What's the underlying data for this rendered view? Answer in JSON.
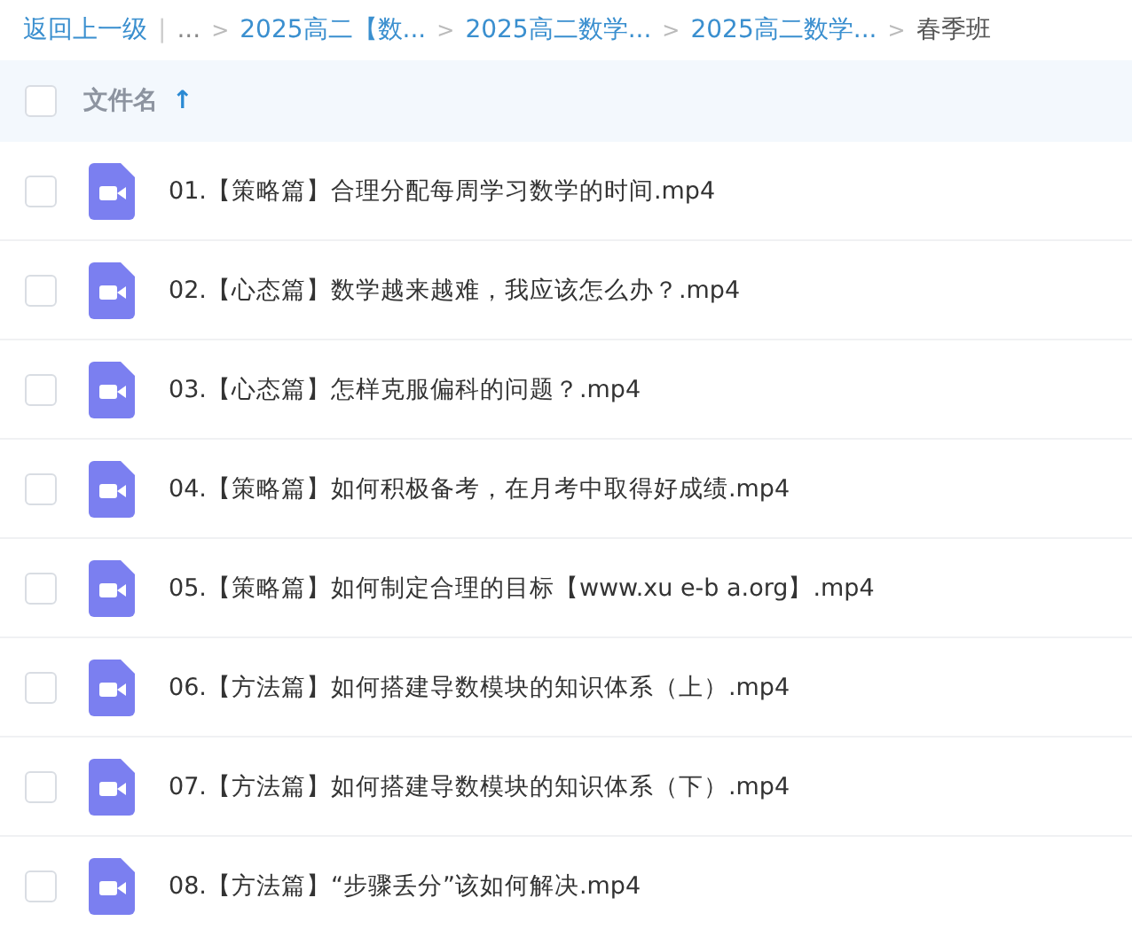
{
  "breadcrumb": [
    {
      "kind": "link",
      "text": "返回上一级"
    },
    {
      "kind": "divider",
      "text": "|"
    },
    {
      "kind": "plain",
      "text": "..."
    },
    {
      "kind": "separator",
      "text": ">"
    },
    {
      "kind": "link",
      "text": "2025高二【数..."
    },
    {
      "kind": "separator",
      "text": ">"
    },
    {
      "kind": "link",
      "text": "2025高二数学..."
    },
    {
      "kind": "separator",
      "text": ">"
    },
    {
      "kind": "link",
      "text": "2025高二数学..."
    },
    {
      "kind": "separator",
      "text": ">"
    },
    {
      "kind": "current",
      "text": "春季班"
    }
  ],
  "header": {
    "checked": false,
    "column": "文件名",
    "sort_arrow": "↑"
  },
  "files": [
    {
      "name": "01.【策略篇】合理分配每周学习数学的时间.mp4",
      "checked": false
    },
    {
      "name": "02.【心态篇】数学越来越难，我应该怎么办？.mp4",
      "checked": false
    },
    {
      "name": "03.【心态篇】怎样克服偏科的问题？.mp4",
      "checked": false
    },
    {
      "name": "04.【策略篇】如何积极备考，在月考中取得好成绩.mp4",
      "checked": false
    },
    {
      "name": "05.【策略篇】如何制定合理的目标【www.xu e-b a.org】.mp4",
      "checked": false
    },
    {
      "name": "06.【方法篇】如何搭建导数模块的知识体系（上）.mp4",
      "checked": false
    },
    {
      "name": "07.【方法篇】如何搭建导数模块的知识体系（下）.mp4",
      "checked": false
    },
    {
      "name": "08.【方法篇】“步骤丢分”该如何解决.mp4",
      "checked": false
    }
  ]
}
